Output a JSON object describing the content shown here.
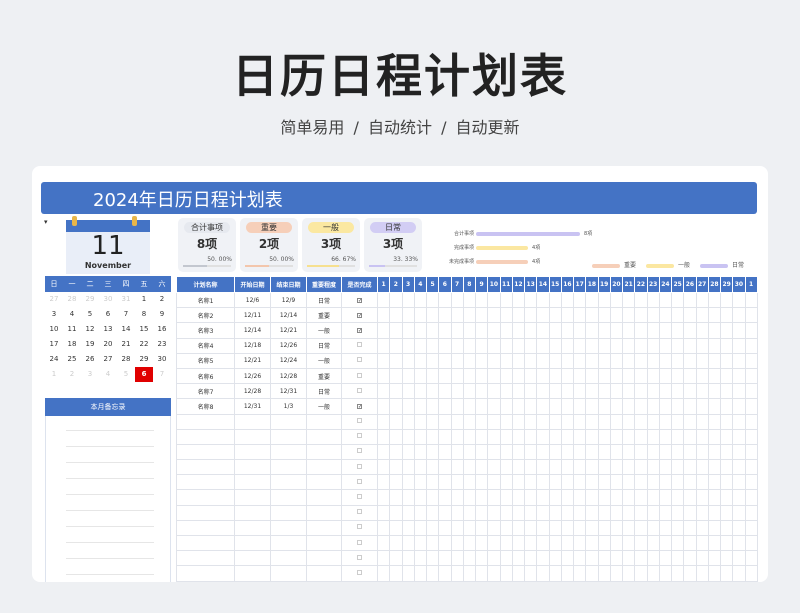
{
  "hero": {
    "title": "日历日程计划表",
    "subtitle": "简单易用   /   自动统计   /   自动更新"
  },
  "sheet": {
    "banner_title": "2024年日历日程计划表",
    "corner_mark": "▾",
    "date_card": {
      "day": "11",
      "month": "November"
    },
    "stats": [
      {
        "label": "合计事项",
        "value": "8项",
        "pct": "50. 00%",
        "pill_color": "#e6e9ef",
        "fill_color": "#c3c7cf",
        "fraction": 0.5
      },
      {
        "label": "重要",
        "value": "2项",
        "pct": "50. 00%",
        "pill_color": "#f6cfb9",
        "fill_color": "#f3c6ac",
        "fraction": 0.5
      },
      {
        "label": "一般",
        "value": "3项",
        "pct": "66. 67%",
        "pill_color": "#fbe8a1",
        "fill_color": "#f6e08f",
        "fraction": 0.6667
      },
      {
        "label": "日常",
        "value": "3项",
        "pct": "33. 33%",
        "pill_color": "#d2cdf4",
        "fill_color": "#c9c3f2",
        "fraction": 0.3333
      }
    ],
    "progress": [
      {
        "label": "合计事项",
        "value": "8項",
        "count": 8,
        "color": "#c9c3f2"
      },
      {
        "label": "完成事项",
        "value": "4項",
        "count": 4,
        "color": "#fbe7a1"
      },
      {
        "label": "未完成事项",
        "value": "4項",
        "count": 4,
        "color": "#f6cfb9"
      }
    ],
    "legend": [
      {
        "label": "重要",
        "color": "#f6cfb9"
      },
      {
        "label": "一般",
        "color": "#fbe7a1"
      },
      {
        "label": "日常",
        "color": "#c9c3f2"
      }
    ],
    "calendar": {
      "weekdays": [
        "日",
        "一",
        "二",
        "三",
        "四",
        "五",
        "六"
      ],
      "weeks": [
        [
          [
            "27",
            "dim"
          ],
          [
            "28",
            "dim"
          ],
          [
            "29",
            "dim"
          ],
          [
            "30",
            "dim"
          ],
          [
            "31",
            "dim"
          ],
          [
            "1",
            ""
          ],
          [
            "2",
            ""
          ]
        ],
        [
          [
            "3",
            ""
          ],
          [
            "4",
            ""
          ],
          [
            "5",
            ""
          ],
          [
            "6",
            ""
          ],
          [
            "7",
            ""
          ],
          [
            "8",
            ""
          ],
          [
            "9",
            ""
          ]
        ],
        [
          [
            "10",
            ""
          ],
          [
            "11",
            ""
          ],
          [
            "12",
            ""
          ],
          [
            "13",
            ""
          ],
          [
            "14",
            ""
          ],
          [
            "15",
            ""
          ],
          [
            "16",
            ""
          ]
        ],
        [
          [
            "17",
            ""
          ],
          [
            "18",
            ""
          ],
          [
            "19",
            ""
          ],
          [
            "20",
            ""
          ],
          [
            "21",
            ""
          ],
          [
            "22",
            ""
          ],
          [
            "23",
            ""
          ]
        ],
        [
          [
            "24",
            ""
          ],
          [
            "25",
            ""
          ],
          [
            "26",
            ""
          ],
          [
            "27",
            ""
          ],
          [
            "28",
            ""
          ],
          [
            "29",
            ""
          ],
          [
            "30",
            ""
          ]
        ],
        [
          [
            "1",
            "dim"
          ],
          [
            "2",
            "dim"
          ],
          [
            "3",
            "dim"
          ],
          [
            "4",
            "dim"
          ],
          [
            "5",
            "dim"
          ],
          [
            "6",
            "today"
          ],
          [
            "7",
            "dim"
          ]
        ]
      ]
    },
    "memo_title": "本月备忘录",
    "plan": {
      "headers": [
        "计划名称",
        "开始日期",
        "结束日期",
        "重要程度",
        "是否完成"
      ],
      "days": [
        "1",
        "2",
        "3",
        "4",
        "5",
        "6",
        "7",
        "8",
        "9",
        "10",
        "11",
        "12",
        "13",
        "14",
        "15",
        "16",
        "17",
        "18",
        "19",
        "20",
        "21",
        "22",
        "23",
        "24",
        "25",
        "26",
        "27",
        "28",
        "29",
        "30",
        "1"
      ],
      "rows": [
        {
          "name": "名称1",
          "start": "12/6",
          "end": "12/9",
          "level": "日常",
          "done": true
        },
        {
          "name": "名称2",
          "start": "12/11",
          "end": "12/14",
          "level": "重要",
          "done": true
        },
        {
          "name": "名称3",
          "start": "12/14",
          "end": "12/21",
          "level": "一般",
          "done": true
        },
        {
          "name": "名称4",
          "start": "12/18",
          "end": "12/26",
          "level": "日常",
          "done": false
        },
        {
          "name": "名称5",
          "start": "12/21",
          "end": "12/24",
          "level": "一般",
          "done": false
        },
        {
          "name": "名称6",
          "start": "12/26",
          "end": "12/28",
          "level": "重要",
          "done": false
        },
        {
          "name": "名称7",
          "start": "12/28",
          "end": "12/31",
          "level": "日常",
          "done": false
        },
        {
          "name": "名称8",
          "start": "12/31",
          "end": "1/3",
          "level": "一般",
          "done": true
        }
      ],
      "empty_rows": 11
    }
  }
}
